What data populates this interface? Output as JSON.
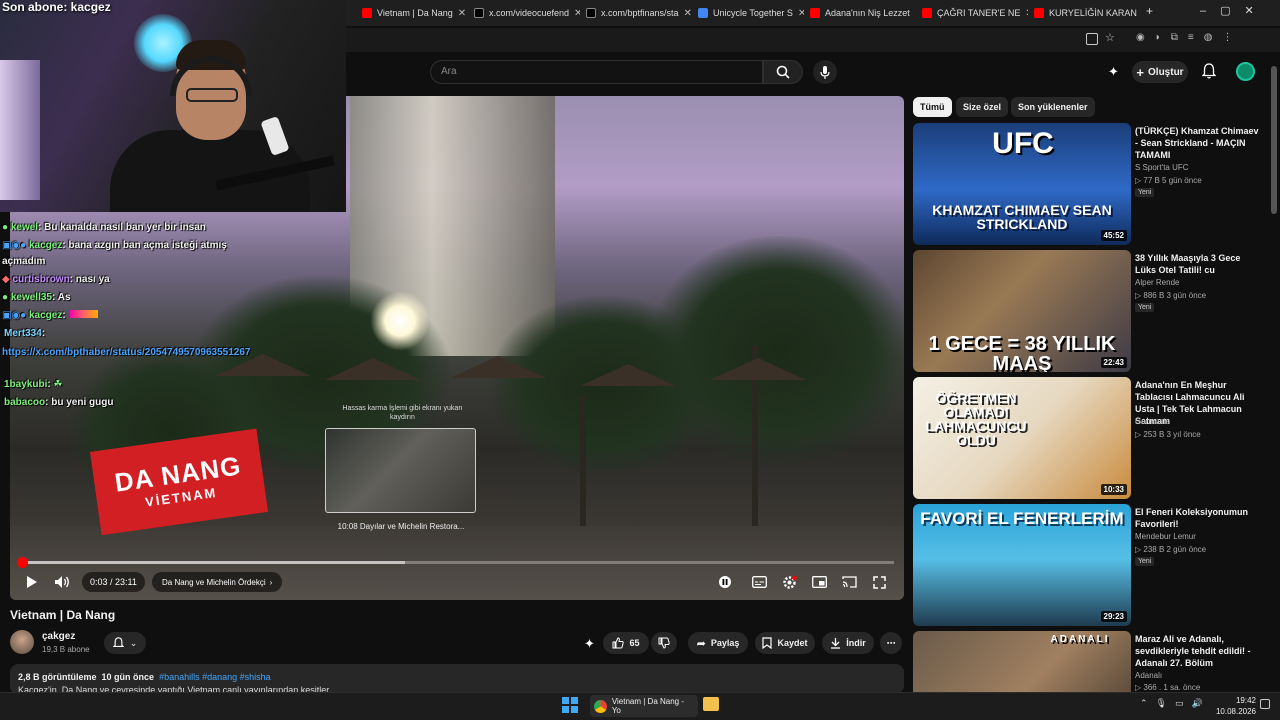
{
  "overlay": {
    "subscriber_banner": "Son abone: kacgez"
  },
  "browser": {
    "tabs": [
      {
        "label": "Vietnam | Da Nang",
        "color": "#ff0000"
      },
      {
        "label": "x.com/videocuefend",
        "color": "#000000"
      },
      {
        "label": "x.com/bptfinans/sta",
        "color": "#000000"
      },
      {
        "label": "Unicycle Together S",
        "color": "#4285f4"
      },
      {
        "label": "Adana'nın Niş Lezzet",
        "color": "#ff0000"
      },
      {
        "label": "ÇAĞRI TANER'E NE",
        "color": "#ff0000"
      },
      {
        "label": "KURYELİĞİN KARAN",
        "color": "#ff0000"
      }
    ]
  },
  "header": {
    "search_placeholder": "Ara",
    "create_label": "Oluştur"
  },
  "chat": {
    "messages": [
      {
        "user": "kewel",
        "text": ": Bu kanalda nasıl ban yer bir insan"
      },
      {
        "user": "kacgez",
        "text": ": bana azgın ban açma isteği atmış"
      },
      {
        "user": "",
        "text": "açmadım"
      },
      {
        "user": "curtisbrown",
        "text": ": nası ya"
      },
      {
        "user": "kewell35",
        "text": ": As"
      },
      {
        "user": "kacgez",
        "text": ":"
      },
      {
        "user": "Mert334",
        "text": ":"
      },
      {
        "user": "",
        "text": "https://x.com/bpthaber/status/2054749570963551267",
        "is_link": true
      },
      {
        "user": "1baykubi",
        "text": ":"
      },
      {
        "user": "babacoo",
        "text": ": bu yeni gugu"
      }
    ]
  },
  "video": {
    "badge_title": "DA NANG",
    "badge_subtitle": "VİETNAM",
    "preview_hint": "Hassas karma İşlemi gibi ekranı yukarı kaydırın",
    "preview_caption": "10:08  Dayılar ve Michelin Restora...",
    "current_time": "0:03",
    "duration": "23:11",
    "time_display": "0:03 / 23:11",
    "chapter_label": "Da Nang ve Michelin Ördekçi",
    "played_fraction": 0.002,
    "loaded_fraction": 0.44
  },
  "meta": {
    "title": "Vietnam | Da Nang",
    "channel_name": "çakgez",
    "channel_subs": "19,3 B abone",
    "likes": "65",
    "share_label": "Paylaş",
    "save_label": "Kaydet",
    "download_label": "İndir",
    "views": "2,8 B görüntüleme",
    "age": "10 gün önce",
    "tags": "#banahills #danang #shisha",
    "description": "Kacgez'in, Da Nang ve çevresinde yaptığı Vietnam canlı yayınlarından kesitler"
  },
  "chips": [
    {
      "label": "Tümü",
      "active": true
    },
    {
      "label": "Size özel",
      "active": false
    },
    {
      "label": "Son yüklenenler",
      "active": false
    }
  ],
  "recommendations": [
    {
      "title": "(TÜRKÇE) Khamzat Chimaev - Sean Strickland - MAÇIN TAMAMI",
      "channel": "S Sport'ta UFC",
      "meta": "▷ 77 B   5 gün önce",
      "badge": "Yeni",
      "duration": "45:52",
      "thumb_text": "KHAMZAT CHIMAEV SEAN STRICKLAND",
      "thumb_top": "UFC"
    },
    {
      "title": "38 Yıllık Maaşıyla 3 Gece Lüks Otel Tatili! cu",
      "channel": "Alper Rende",
      "meta": "▷ 886 B   3 gün önce",
      "badge": "Yeni",
      "duration": "22:43",
      "thumb_text": "1 GECE = 38 YILLIK MAAŞ",
      "thumb_top": ""
    },
    {
      "title": "Adana'nın En Meşhur Tablacısı Lahmacuncu Ali Usta | Tek Tek Lahmacun Satmam",
      "channel": "Gurmosis",
      "meta": "▷ 253 B   3 yıl önce",
      "badge": "",
      "duration": "10:33",
      "thumb_text": "ÖĞRETMEN OLAMADI LAHMACUNCU OLDU",
      "thumb_top": ""
    },
    {
      "title": "El Feneri Koleksiyonumun Favorileri!",
      "channel": "Mendebur Lemur",
      "meta": "▷ 238 B   2 gün önce",
      "badge": "Yeni",
      "duration": "29:23",
      "thumb_text": "FAVORİ EL FENERLERİM",
      "thumb_top": ""
    },
    {
      "title": "Maraz Ali ve Adanalı, sevdikleriyle tehdit edildi! - Adanalı 27. Bölüm",
      "channel": "Adanalı",
      "meta": "▷ 366 .   1 sa. önce",
      "badge": "",
      "duration": "",
      "thumb_text": "ADANALI",
      "thumb_top": ""
    }
  ],
  "taskbar": {
    "chrome_label": "Vietnam | Da Nang - Yo",
    "time": "19:42",
    "date": "10.08.2026"
  },
  "colors": {
    "accent_red": "#ff0000",
    "chip_active_bg": "#f1f1f1",
    "link_blue": "#3ea6ff"
  }
}
